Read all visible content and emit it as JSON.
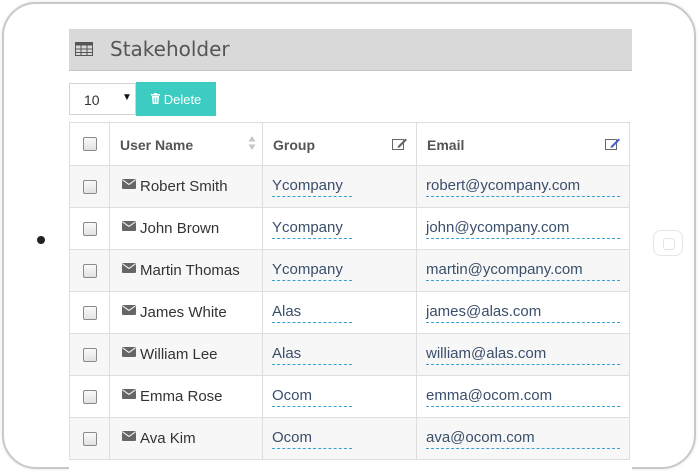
{
  "panel": {
    "title": "Stakeholder"
  },
  "toolbar": {
    "page_size": "10",
    "delete_label": "Delete"
  },
  "table": {
    "columns": [
      {
        "label": "User Name"
      },
      {
        "label": "Group"
      },
      {
        "label": "Email"
      }
    ],
    "rows": [
      {
        "name": "Robert Smith",
        "group": "Ycompany",
        "email": "robert@ycompany.com"
      },
      {
        "name": "John Brown",
        "group": "Ycompany",
        "email": "john@ycompany.com"
      },
      {
        "name": "Martin Thomas",
        "group": "Ycompany",
        "email": "martin@ycompany.com"
      },
      {
        "name": "James White",
        "group": "Alas",
        "email": "james@alas.com"
      },
      {
        "name": "William Lee",
        "group": "Alas",
        "email": "william@alas.com"
      },
      {
        "name": "Emma Rose",
        "group": "Ocom",
        "email": "emma@ocom.com"
      },
      {
        "name": "Ava Kim",
        "group": "Ocom",
        "email": "ava@ocom.com"
      }
    ]
  },
  "colors": {
    "accent": "#3cccc1",
    "link_underline": "#3aa0d0",
    "header_bg": "#d9d9d9"
  },
  "icons": [
    "table-grid-icon",
    "trash-icon",
    "sort-icon",
    "edit-icon",
    "envelope-icon"
  ]
}
